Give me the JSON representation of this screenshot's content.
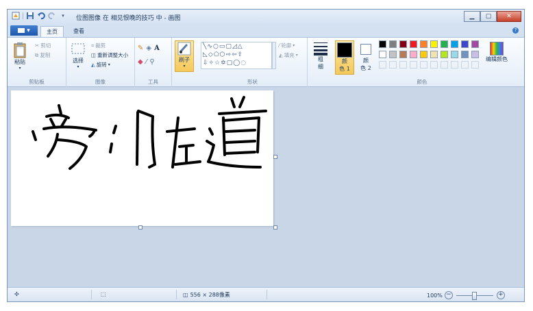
{
  "window": {
    "title": "位图图像 在 相见恨晚的技巧 中 - 画图",
    "controls": [
      "minimize",
      "maximize",
      "close"
    ]
  },
  "tabs": {
    "file_label": "▾",
    "home_label": "主页",
    "view_label": "查看"
  },
  "ribbon": {
    "clipboard": {
      "paste_label": "粘贴",
      "cut_label": "剪切",
      "copy_label": "复制",
      "group_label": "剪贴板"
    },
    "image": {
      "select_label": "选择",
      "crop_label": "裁剪",
      "resize_label": "重新调整大小",
      "rotate_label": "旋转",
      "group_label": "图像"
    },
    "tools": {
      "group_label": "工具"
    },
    "brushes": {
      "label": "刷子"
    },
    "shapes": {
      "outline_label": "轮廓",
      "fill_label": "填充",
      "group_label": "形状"
    },
    "size": {
      "label_1": "粗",
      "label_2": "细"
    },
    "colors": {
      "color1_label_1": "颜",
      "color1_label_2": "色 1",
      "color2_label_1": "颜",
      "color2_label_2": "色 2",
      "edit_label": "编辑颜色",
      "group_label": "颜色",
      "color1": "#000000",
      "color2": "#ffffff",
      "palette_row1": [
        "#000000",
        "#7f7f7f",
        "#880015",
        "#ed1c24",
        "#ff7f27",
        "#fff200",
        "#22b14c",
        "#00a2e8",
        "#3f48cc",
        "#a349a4"
      ],
      "palette_row2": [
        "#ffffff",
        "#c3c3c3",
        "#b97a57",
        "#ffaec9",
        "#ffc90e",
        "#efe4b0",
        "#b5e61d",
        "#99d9ea",
        "#7092be",
        "#c8bfe7"
      ]
    }
  },
  "status": {
    "dimensions": "556 × 288像素",
    "zoom": "100%"
  }
}
